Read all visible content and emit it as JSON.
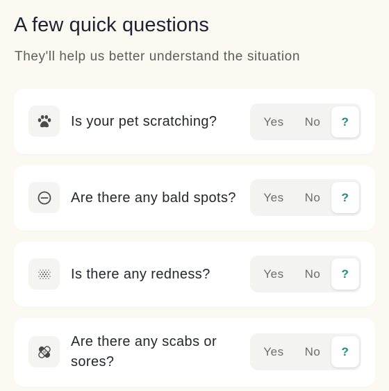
{
  "header": {
    "title": "A few quick questions",
    "subtitle": "They'll help us better understand the situation"
  },
  "accent_color": "#1f8a82",
  "questions": [
    {
      "icon": "paw-icon",
      "text": "Is your pet scratching?",
      "options": {
        "yes": "Yes",
        "no": "No",
        "unknown": "?"
      },
      "selected": "unknown"
    },
    {
      "icon": "minus-circle-icon",
      "text": "Are there any bald spots?",
      "options": {
        "yes": "Yes",
        "no": "No",
        "unknown": "?"
      },
      "selected": "unknown"
    },
    {
      "icon": "dot-grid-icon",
      "text": "Is there any redness?",
      "options": {
        "yes": "Yes",
        "no": "No",
        "unknown": "?"
      },
      "selected": "unknown"
    },
    {
      "icon": "bandage-icon",
      "text_line1": "Are there any scabs or",
      "text_line2": "sores?",
      "options": {
        "yes": "Yes",
        "no": "No",
        "unknown": "?"
      },
      "selected": "unknown"
    }
  ]
}
